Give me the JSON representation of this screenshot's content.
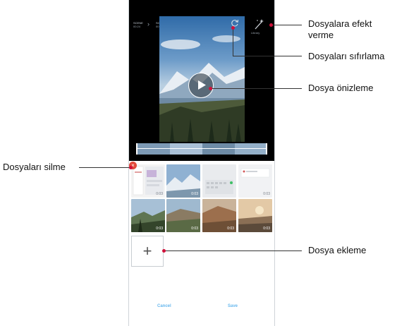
{
  "header": {
    "crumb1_title": "SCENE",
    "crumb1_sub": "00:24",
    "crumb2_title": "SCENE",
    "crumb2_sub": "00:24",
    "effect_label": "Library"
  },
  "thumbnails": [
    {
      "duration": "0:03"
    },
    {
      "duration": "0:03"
    },
    {
      "duration": ""
    },
    {
      "duration": "0:03"
    },
    {
      "duration": "0:03"
    },
    {
      "duration": "0:03"
    },
    {
      "duration": "0:03"
    },
    {
      "duration": "0:03"
    }
  ],
  "buttons": {
    "add_icon": "+",
    "delete_icon": "×",
    "cancel": "Cancel",
    "save": "Save"
  },
  "callouts": {
    "effects": "Dosyalara efekt verme",
    "reset": "Dosyaları sıfırlama",
    "preview": "Dosya önizleme",
    "delete": "Dosyaları silme",
    "add": "Dosya ekleme"
  },
  "icons": [
    "magic-wand-icon",
    "reset-icon",
    "play-icon",
    "delete-icon",
    "add-icon"
  ],
  "colors": {
    "accent": "#67b8ee",
    "delete": "#e24a3b",
    "callout_dot": "#d0103a"
  }
}
